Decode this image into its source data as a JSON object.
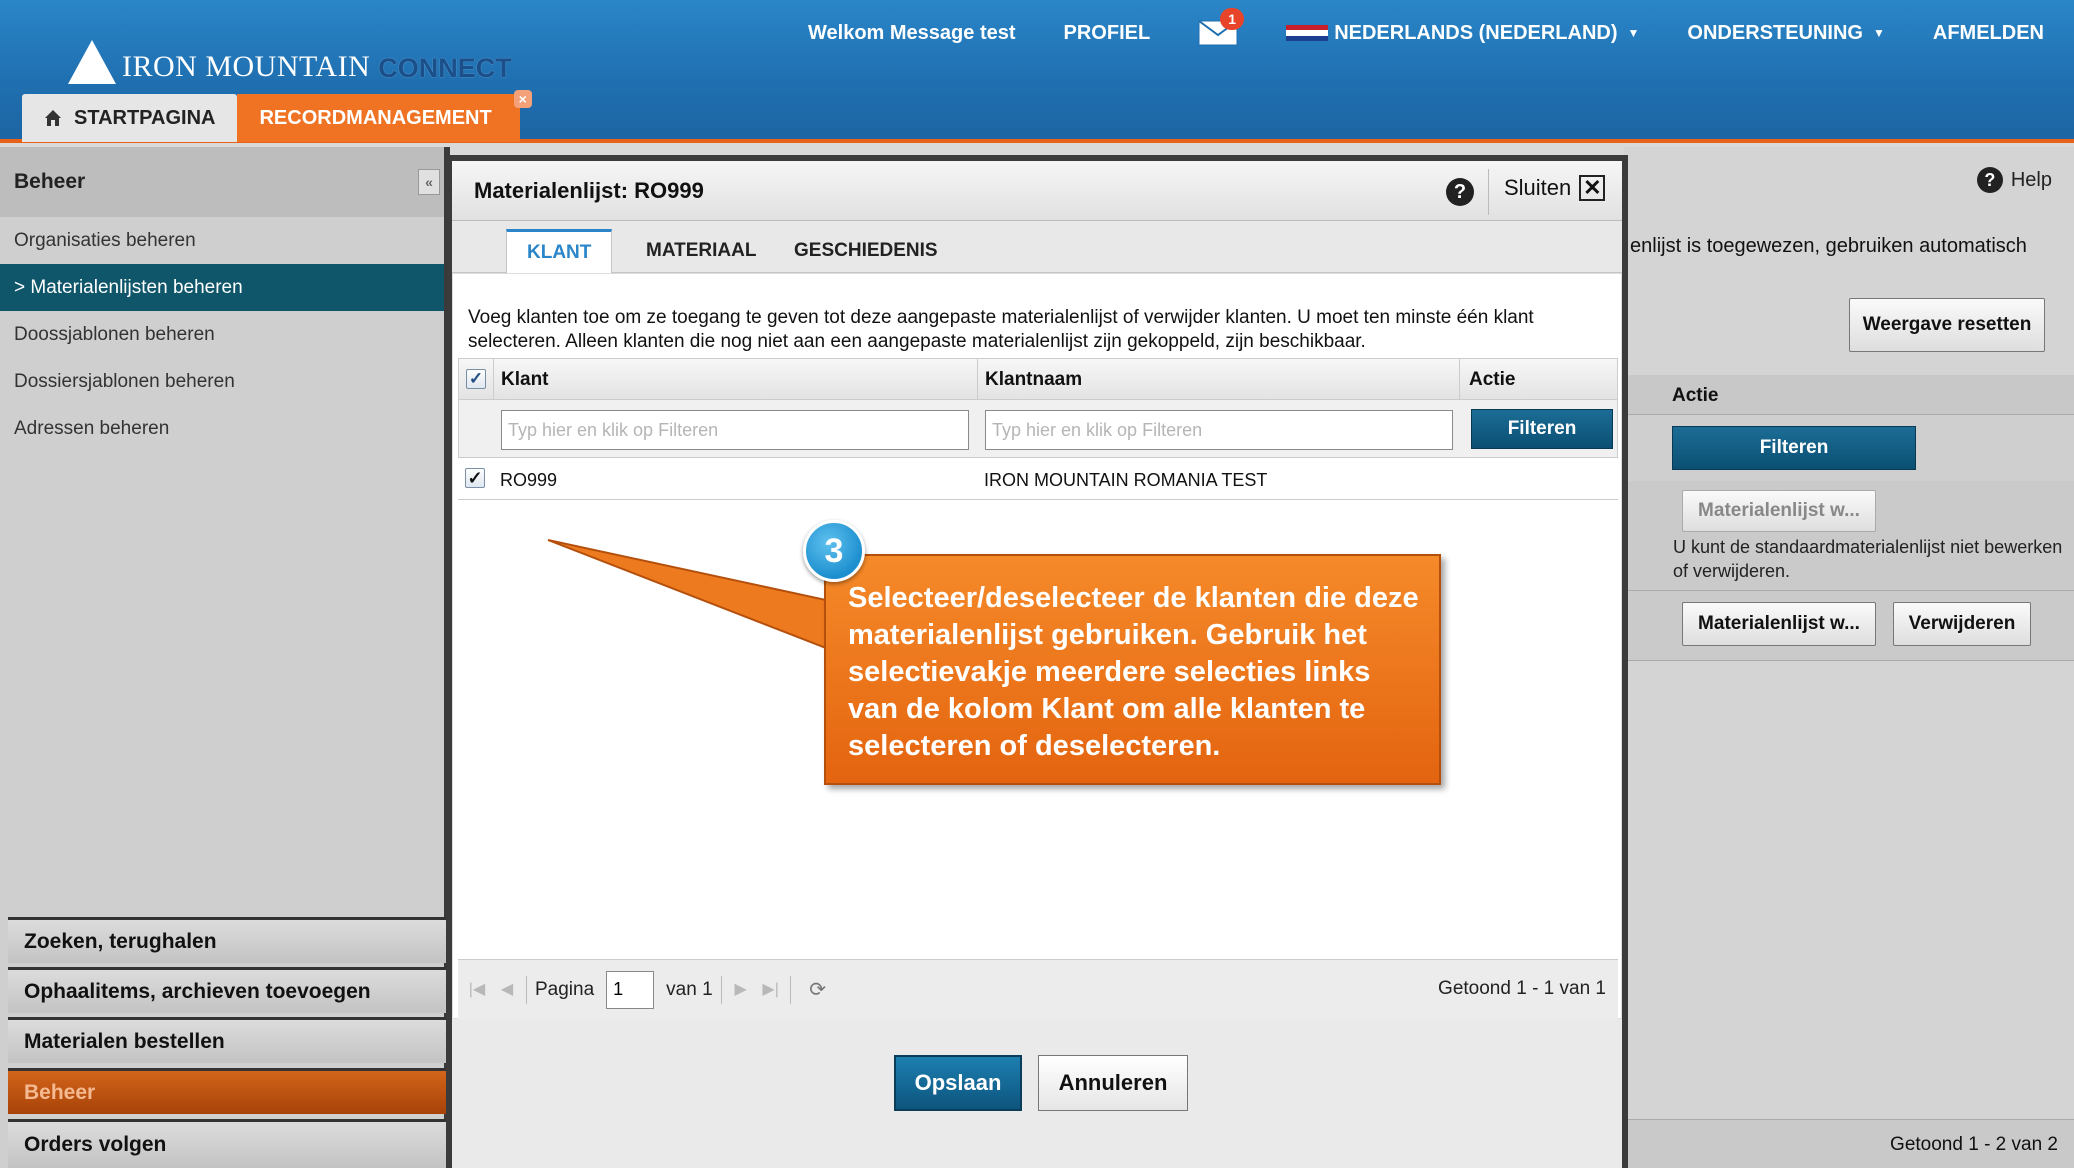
{
  "header": {
    "logo_text": "IRON MOUNTAIN",
    "logo_connect": "CONNECT",
    "welcome": "Welkom Message test",
    "profile": "PROFIEL",
    "mail_count": "1",
    "language": "NEDERLANDS (NEDERLAND)",
    "support": "ONDERSTEUNING",
    "logout": "AFMELDEN",
    "tabs": {
      "home": "STARTPAGINA",
      "records": "RECORDMANAGEMENT"
    }
  },
  "sidebar": {
    "title": "Beheer",
    "items": [
      {
        "label": "Organisaties beheren"
      },
      {
        "label": "> Materialenlijsten beheren"
      },
      {
        "label": "Doossjablonen beheren"
      },
      {
        "label": "Dossiersjablonen beheren"
      },
      {
        "label": "Adressen beheren"
      }
    ],
    "accordion": [
      {
        "label": "Zoeken, terughalen"
      },
      {
        "label": "Ophaalitems, archieven toevoegen"
      },
      {
        "label": "Materialen bestellen"
      },
      {
        "label": "Beheer"
      },
      {
        "label": "Orders volgen"
      }
    ]
  },
  "background_panel": {
    "help": "Help",
    "text": "enlijst is toegewezen, gebruiken automatisch",
    "reset_button": "Weergave resetten",
    "col_action": "Actie",
    "filter_button": "Filteren",
    "row1_button": "Materialenlijst w...",
    "note": "U kunt de standaardmaterialenlijst niet bewerken of verwijderen.",
    "row2_button": "Materialenlijst w...",
    "delete_button": "Verwijderen",
    "footer": "Getoond 1 - 2 van 2"
  },
  "modal": {
    "title": "Materialenlijst: RO999",
    "close": "Sluiten",
    "tabs": [
      "KLANT",
      "MATERIAAL",
      "GESCHIEDENIS"
    ],
    "intro": "Voeg klanten toe om ze toegang te geven tot deze aangepaste materialenlijst of verwijder klanten. U moet ten minste één klant selecteren. Alleen klanten die nog niet aan een aangepaste materialenlijst zijn gekoppeld, zijn beschikbaar.",
    "columns": {
      "client": "Klant",
      "client_name": "Klantnaam",
      "action": "Actie"
    },
    "filter_placeholder": "Typ hier en klik op Filteren",
    "filter_button": "Filteren",
    "rows": [
      {
        "client": "RO999",
        "client_name": "IRON MOUNTAIN ROMANIA TEST",
        "checked": true
      }
    ],
    "pager": {
      "page_label": "Pagina",
      "page": "1",
      "of": "van 1",
      "shown": "Getoond 1 - 1 van 1"
    },
    "save": "Opslaan",
    "cancel": "Annuleren"
  },
  "callout": {
    "step": "3",
    "text": "Selecteer/deselecteer de klanten die deze materialenlijst gebruiken.  Gebruik het selectievakje meerdere selecties links van de kolom Klant om alle klanten te selecteren of deselecteren."
  },
  "colors": {
    "header_blue": "#1f6fb0",
    "accent_orange": "#f07324",
    "active_item": "#0f566b",
    "button_blue": "#0d557e"
  }
}
